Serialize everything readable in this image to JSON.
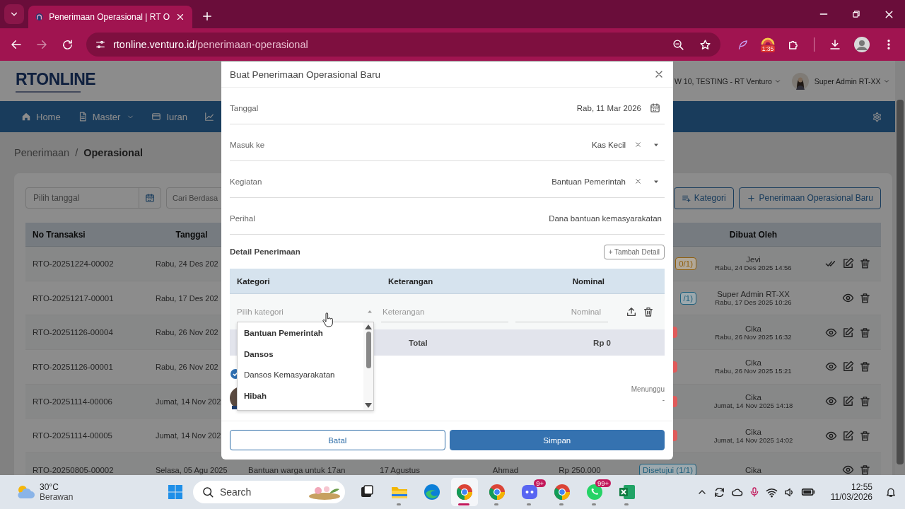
{
  "browser": {
    "tab_title": "Penerimaan Operasional | RT O",
    "url_domain": "rtonline.venturo.id",
    "url_path": "/penerimaan-operasional",
    "extension_badge": "1:35"
  },
  "header": {
    "logo": "RTONLINE",
    "org_selector": "W 10, TESTING - RT Venturo",
    "user": "Super Admin RT-XX"
  },
  "nav": [
    {
      "kind": "home",
      "label": "Home",
      "dropdown": false
    },
    {
      "kind": "document",
      "label": "Master",
      "dropdown": true
    },
    {
      "kind": "card",
      "label": "Iuran",
      "dropdown": false
    },
    {
      "kind": "chart"
    }
  ],
  "breadcrumb": {
    "parent": "Penerimaan",
    "separator": "/",
    "current": "Operasional"
  },
  "filters": {
    "date_placeholder": "Pilih tanggal",
    "search_placeholder": "Cari Berdasa"
  },
  "actions": [
    {
      "kind": "category",
      "label": "Kategori"
    },
    {
      "kind": "add",
      "label": "Penerimaan Operasional Baru"
    }
  ],
  "table": {
    "columns": {
      "no": "No Transaksi",
      "date": "Tanggal",
      "created_by": "Dibuat Oleh"
    },
    "rows": [
      {
        "no": "RTO-20251224-00002",
        "date": "Rabu, 24 Des 202",
        "status": {
          "text": "0/1)",
          "color": "#8f5e0c"
        },
        "created_by": "Jevi",
        "created_at": "Rabu, 24 Des 2025 14:56",
        "needs_approval": true,
        "editable": true
      },
      {
        "no": "RTO-20251217-00001",
        "date": "Rabu, 17 Des 202",
        "status": {
          "text": "/1)",
          "color": "#1d5f7c"
        },
        "created_by": "Super Admin RT-XX",
        "created_at": "Rabu, 17 Des 2025 10:26",
        "needs_approval": false,
        "editable": false
      },
      {
        "no": "RTO-20251126-00004",
        "date": "Rabu, 26 Nov 202",
        "status": {
          "color": "#e05a5a"
        },
        "created_by": "Cika",
        "created_at": "Rabu, 26 Nov 2025 16:32",
        "needs_approval": false,
        "editable": true
      },
      {
        "no": "RTO-20251126-00001",
        "date": "Rabu, 26 Nov 202",
        "status": {
          "color": "#e05a5a"
        },
        "created_by": "Cika",
        "created_at": "Rabu, 26 Nov 2025 15:21",
        "needs_approval": false,
        "editable": true
      },
      {
        "no": "RTO-20251114-00006",
        "date": "Jumat, 14 Nov 202",
        "status": {
          "color": "#e05a5a"
        },
        "created_by": "Cika",
        "created_at": "Jumat, 14 Nov 2025 14:18",
        "needs_approval": false,
        "editable": true
      },
      {
        "no": "RTO-20251114-00005",
        "date": "Jumat, 14 Nov 202",
        "status": {
          "color": "#e05a5a"
        },
        "created_by": "Cika",
        "created_at": "Jumat, 14 Nov 2025 14:02",
        "needs_approval": false,
        "editable": true
      },
      {
        "no": "RTO-20250805-00002",
        "date": "Selasa, 05 Agu 2025",
        "description": "Bantuan warga untuk 17an",
        "activity": "17 Agustus",
        "column_5": "Ahmad",
        "amount": "Rp 250.000",
        "status": {
          "text": "Disetujui (1/1)",
          "color": "#1d5f7c"
        },
        "created_by": "Cika",
        "needs_approval": false,
        "editable": false
      }
    ]
  },
  "modal": {
    "title": "Buat Penerimaan Operasional Baru",
    "fields": [
      {
        "kind": "date",
        "label": "Tanggal",
        "value": "Rab, 11 Mar 2026"
      },
      {
        "kind": "select",
        "label": "Masuk ke",
        "value": "Kas Kecil"
      },
      {
        "kind": "select",
        "label": "Kegiatan",
        "value": "Bantuan Pemerintah"
      },
      {
        "kind": "text",
        "label": "Perihal",
        "value": "Dana bantuan kemasyarakatan"
      }
    ],
    "detail_title": "Detail Penerimaan",
    "add_detail_button": "+ Tambah Detail",
    "detail_columns": {
      "category": "Kategori",
      "description": "Keterangan",
      "amount": "Nominal"
    },
    "detail_row": {
      "category_placeholder": "Pilih kategori",
      "category_expanded": true,
      "description_placeholder": "Keterangan",
      "amount_placeholder": "Nominal"
    },
    "total_label": "Total",
    "total_value": "Rp 0",
    "approval": {
      "status": "Menunggu",
      "note": "-"
    },
    "dropdown": [
      {
        "kind": "group",
        "label": "Bantuan Pemerintah"
      },
      {
        "kind": "group",
        "label": "Dansos"
      },
      {
        "kind": "option",
        "label": "Dansos Kemasyarakatan"
      },
      {
        "kind": "group",
        "label": "Hibah"
      }
    ],
    "cancel_button": "Batal",
    "save_button": "Simpan"
  },
  "taskbar": {
    "weather": {
      "temperature": "30°C",
      "condition": "Berawan"
    },
    "search_placeholder": "Search",
    "apps": [
      {
        "kind": "task-view",
        "running": false,
        "selected": false
      },
      {
        "kind": "folder",
        "running": true,
        "selected": false
      },
      {
        "kind": "edge",
        "running": false,
        "selected": false
      },
      {
        "kind": "chrome",
        "running": true,
        "selected": true
      },
      {
        "kind": "chrome",
        "running": true,
        "selected": false
      },
      {
        "kind": "discord",
        "running": true,
        "selected": false,
        "badge": "9+"
      },
      {
        "kind": "chrome",
        "running": true,
        "selected": false
      },
      {
        "kind": "whatsapp",
        "running": true,
        "selected": false,
        "badge": "99+"
      },
      {
        "kind": "excel",
        "running": true,
        "selected": false
      }
    ],
    "time": "12:55",
    "date": "11/03/2026"
  }
}
